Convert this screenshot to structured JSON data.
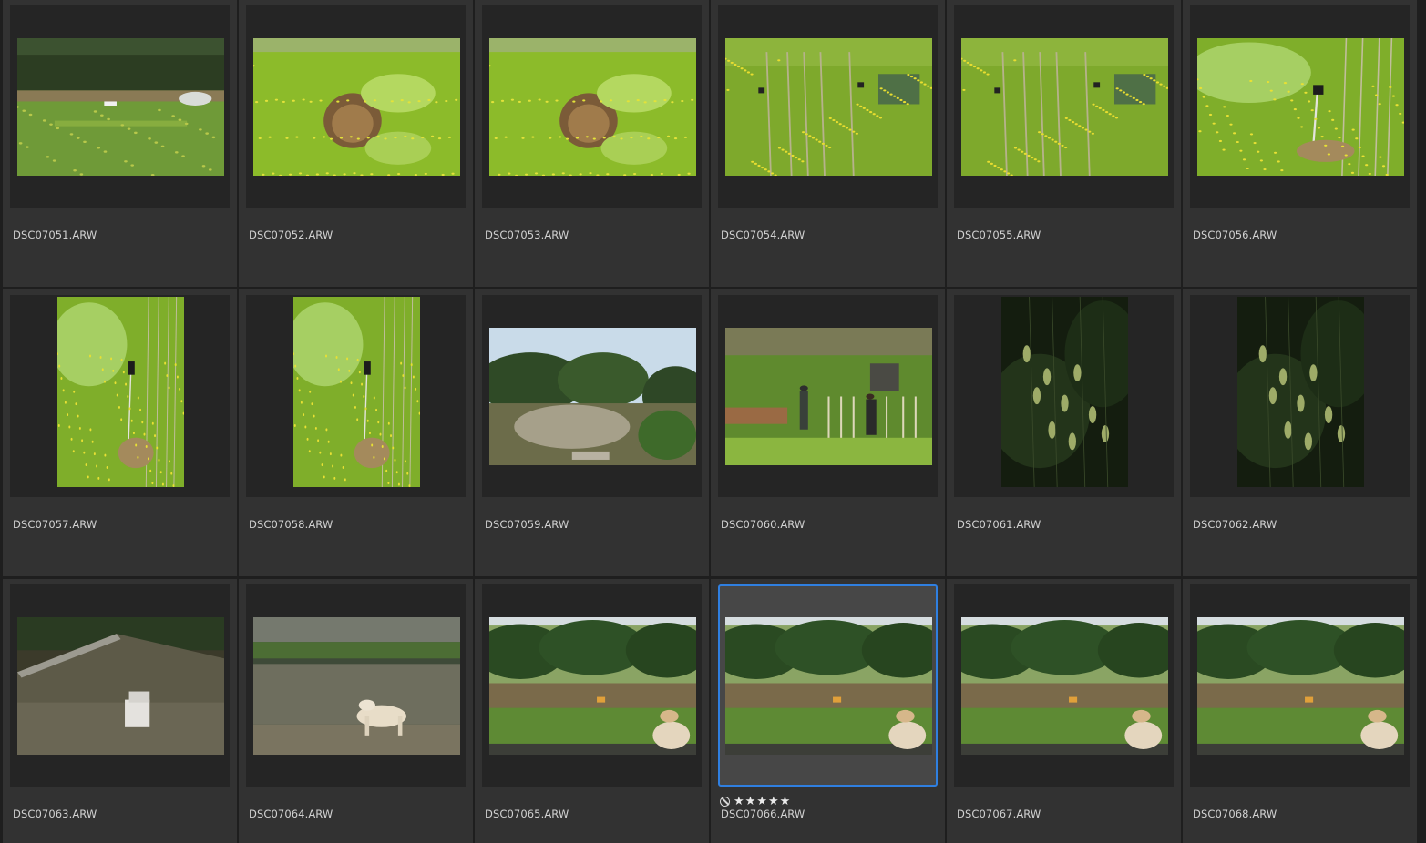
{
  "browser": {
    "selected_index": 15,
    "selected_rating": {
      "reject_icon": "reject-icon",
      "star_icon": "star-icon",
      "star_glyph": "★",
      "stars": 5
    },
    "colors": {
      "background": "#1e1e1e",
      "cell": "#323232",
      "thumb": "#252525",
      "selected_thumb": "#474747",
      "selection_border": "#2f7fe0",
      "text": "#d2d2d2"
    },
    "items": [
      {
        "filename": "DSC07051.ARW",
        "orientation": "landscape",
        "scene": "garden-wide"
      },
      {
        "filename": "DSC07052.ARW",
        "orientation": "landscape",
        "scene": "brush-pile"
      },
      {
        "filename": "DSC07053.ARW",
        "orientation": "landscape",
        "scene": "brush-pile"
      },
      {
        "filename": "DSC07054.ARW",
        "orientation": "landscape",
        "scene": "green-stakes"
      },
      {
        "filename": "DSC07055.ARW",
        "orientation": "landscape",
        "scene": "green-stakes"
      },
      {
        "filename": "DSC07056.ARW",
        "orientation": "landscape",
        "scene": "green-pole"
      },
      {
        "filename": "DSC07057.ARW",
        "orientation": "portrait",
        "scene": "green-pole"
      },
      {
        "filename": "DSC07058.ARW",
        "orientation": "portrait",
        "scene": "green-pole"
      },
      {
        "filename": "DSC07059.ARW",
        "orientation": "landscape",
        "scene": "trees-sky"
      },
      {
        "filename": "DSC07060.ARW",
        "orientation": "landscape",
        "scene": "people-garden"
      },
      {
        "filename": "DSC07061.ARW",
        "orientation": "portrait",
        "scene": "dark-leaves"
      },
      {
        "filename": "DSC07062.ARW",
        "orientation": "portrait",
        "scene": "dark-leaves"
      },
      {
        "filename": "DSC07063.ARW",
        "orientation": "landscape",
        "scene": "concrete-chair"
      },
      {
        "filename": "DSC07064.ARW",
        "orientation": "landscape",
        "scene": "dog-wall"
      },
      {
        "filename": "DSC07065.ARW",
        "orientation": "landscape",
        "scene": "dog-garden"
      },
      {
        "filename": "DSC07066.ARW",
        "orientation": "landscape",
        "scene": "dog-garden"
      },
      {
        "filename": "DSC07067.ARW",
        "orientation": "landscape",
        "scene": "dog-garden"
      },
      {
        "filename": "DSC07068.ARW",
        "orientation": "landscape",
        "scene": "dog-garden"
      }
    ]
  }
}
